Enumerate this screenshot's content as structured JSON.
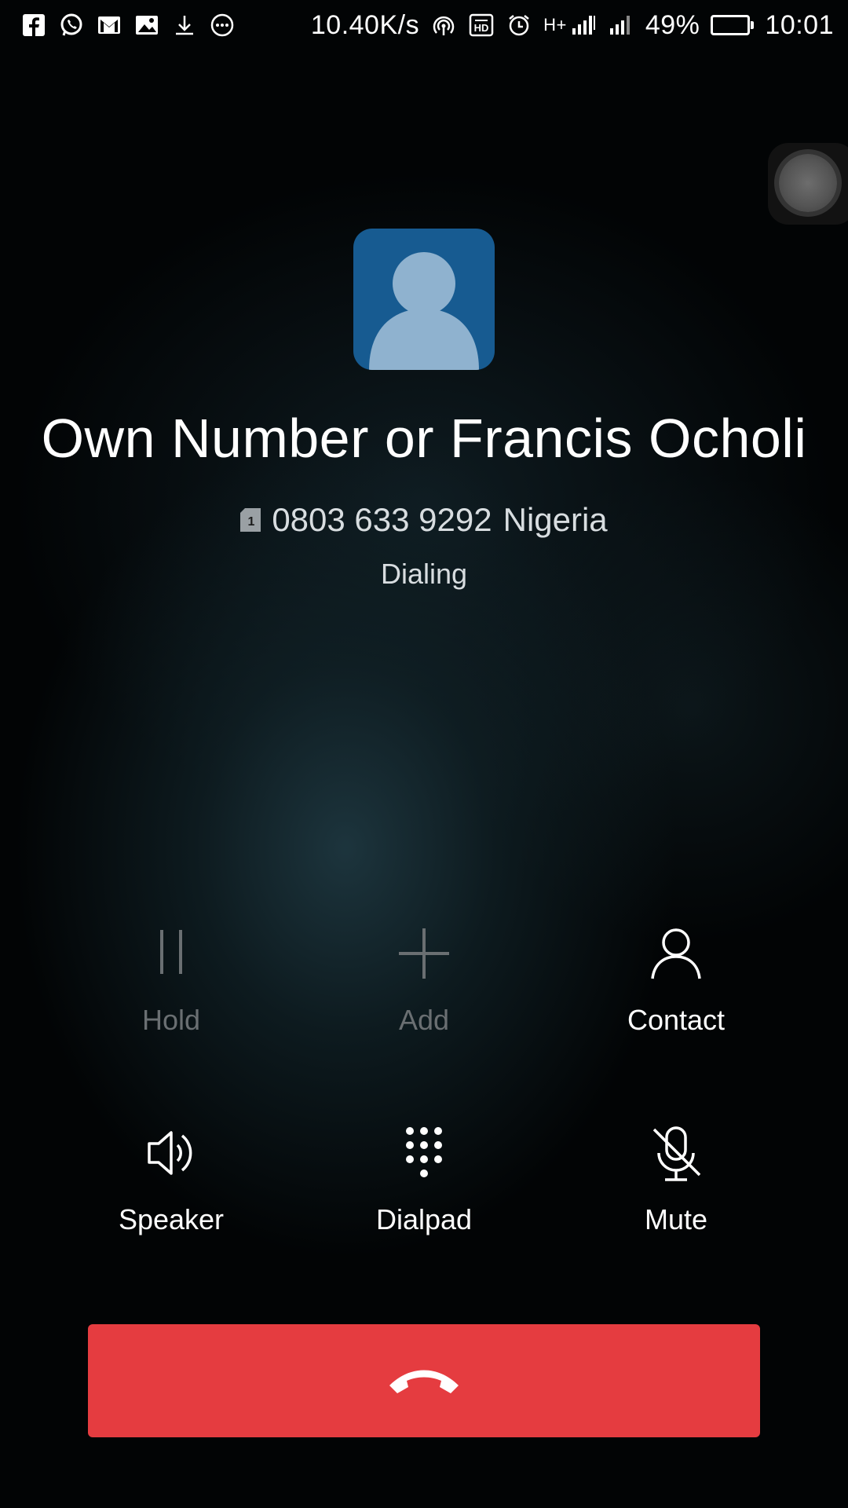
{
  "status_bar": {
    "left_icons": [
      "facebook-icon",
      "whatsapp-icon",
      "gmail-icon",
      "gallery-icon",
      "download-icon",
      "more-notifications-icon"
    ],
    "net_speed": "10.40K/s",
    "network_type": "H+",
    "battery_percent_text": "49%",
    "battery_level": 0.49,
    "time": "10:01"
  },
  "caller": {
    "name": "Own Number or Francis Ocholi",
    "sim_slot": "1",
    "number": "0803 633 9292",
    "location": "Nigeria",
    "status": "Dialing"
  },
  "controls": {
    "hold_label": "Hold",
    "add_label": "Add",
    "contact_label": "Contact",
    "speaker_label": "Speaker",
    "dialpad_label": "Dialpad",
    "mute_label": "Mute"
  },
  "colors": {
    "end_call": "#e53c40",
    "avatar_bg": "#175b91",
    "avatar_fg": "#8fb2cf",
    "disabled": "#6a6f72",
    "battery": "#f5a623"
  }
}
